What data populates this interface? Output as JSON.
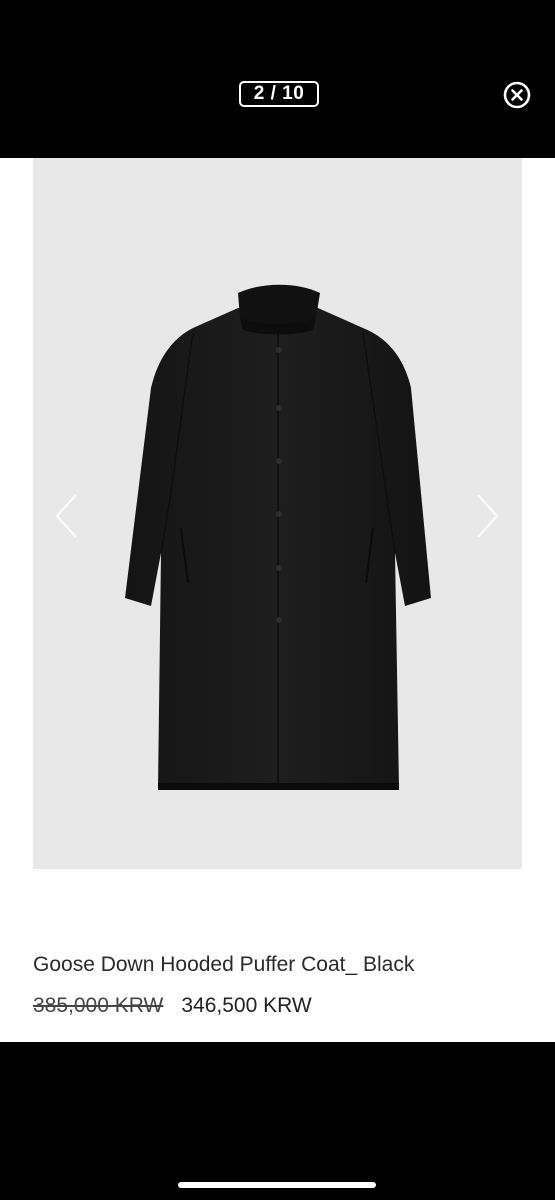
{
  "gallery": {
    "counter": "2 / 10",
    "close_icon": "close-circle-icon",
    "prev_icon": "chevron-left-icon",
    "next_icon": "chevron-right-icon",
    "image": "black-long-coat-product-photo"
  },
  "product": {
    "name": "Goose Down Hooded Puffer Coat_ Black",
    "original_price": "385,000 KRW",
    "sale_price": "346,500 KRW"
  },
  "colors": {
    "background": "#000000",
    "content_bg": "#ffffff",
    "photo_bg": "#e8e8e8",
    "coat": "#1a1a1a"
  }
}
